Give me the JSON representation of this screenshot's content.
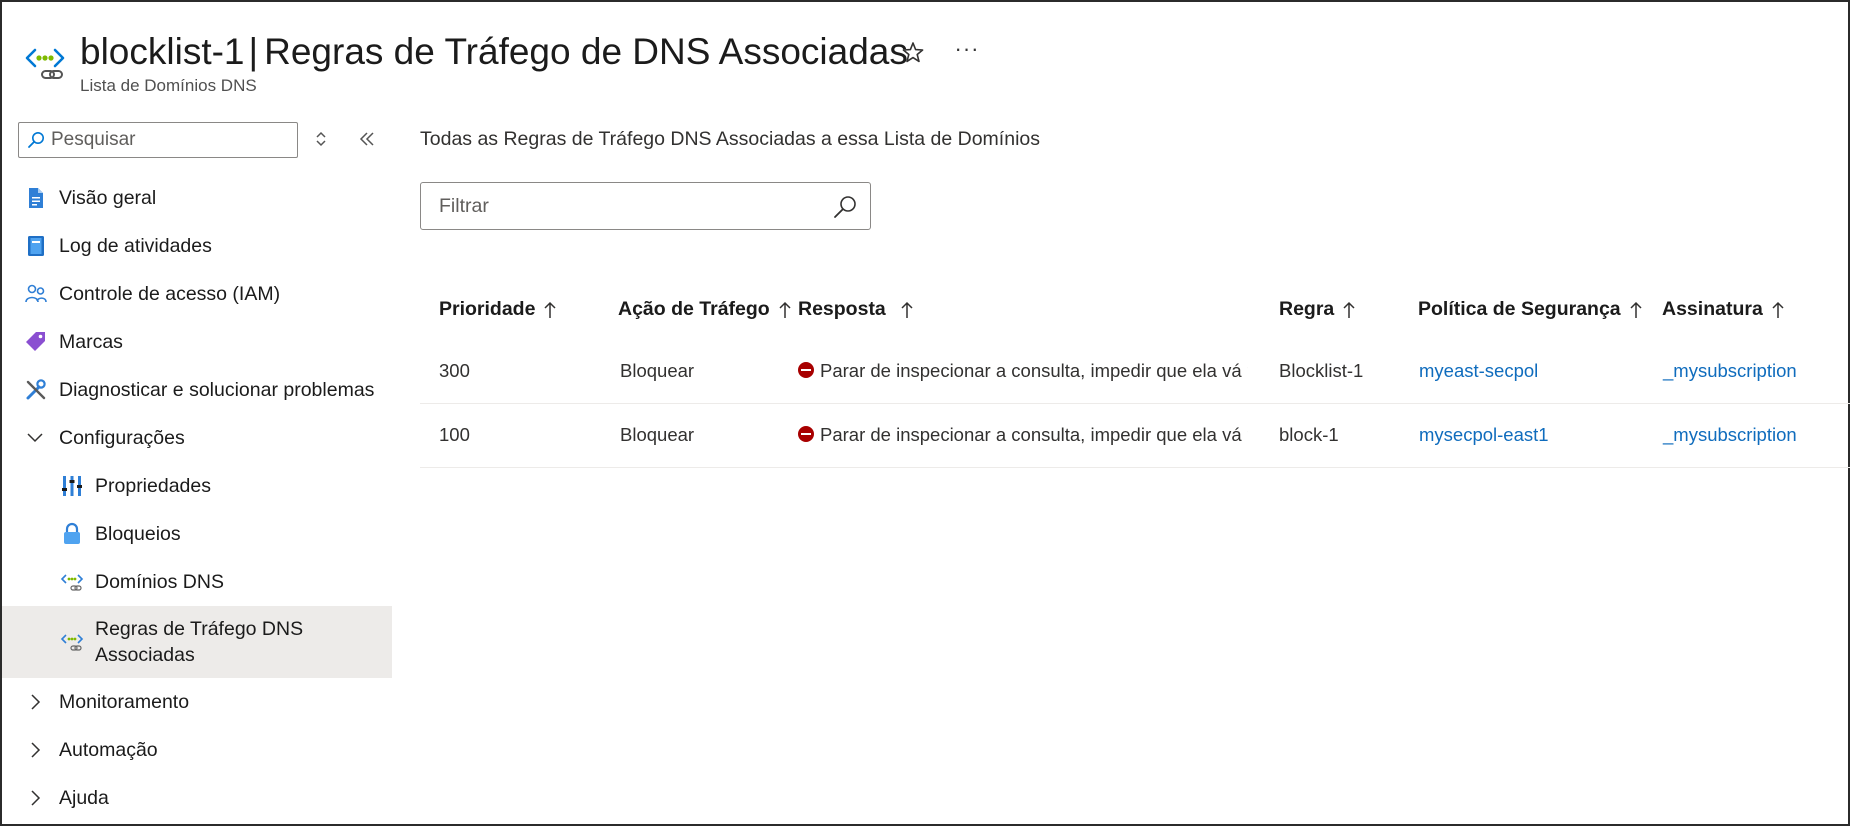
{
  "header": {
    "resource_name": "blocklist-1",
    "separator": "|",
    "page_title": "Regras de Tráfego de DNS Associadas",
    "subtitle": "Lista de Domínios DNS",
    "more_label": "···"
  },
  "sidebar": {
    "search_placeholder": "Pesquisar",
    "items": [
      {
        "label": "Visão geral",
        "icon": "document-icon"
      },
      {
        "label": "Log de atividades",
        "icon": "book-icon"
      },
      {
        "label": "Controle de acesso (IAM)",
        "icon": "people-icon"
      },
      {
        "label": "Marcas",
        "icon": "tag-icon"
      },
      {
        "label": "Diagnosticar e solucionar problemas",
        "icon": "wrench-icon"
      },
      {
        "label": "Configurações",
        "icon": "chevron-down-icon"
      },
      {
        "label": "Propriedades",
        "icon": "properties-icon"
      },
      {
        "label": "Bloqueios",
        "icon": "lock-icon"
      },
      {
        "label": "Domínios DNS",
        "icon": "dns-icon"
      },
      {
        "label": "Regras de Tráfego DNS Associadas",
        "icon": "dns-icon"
      },
      {
        "label": "Monitoramento",
        "icon": "chevron-right-icon"
      },
      {
        "label": "Automação",
        "icon": "chevron-right-icon"
      },
      {
        "label": "Ajuda",
        "icon": "chevron-right-icon"
      }
    ]
  },
  "main": {
    "description": "Todas as Regras de Tráfego DNS Associadas a essa Lista de Domínios",
    "filter_placeholder": "Filtrar",
    "columns": [
      "Prioridade",
      "Ação de Tráfego",
      "Resposta",
      "Regra",
      "Política de Segurança",
      "Assinatura"
    ],
    "rows": [
      {
        "priority": "300",
        "action": "Bloquear",
        "response": "Parar de inspecionar a consulta, impedir que ela vá para",
        "rule": "Blocklist-1",
        "policy": "myeast-secpol",
        "subscription": "_mysubscription"
      },
      {
        "priority": "100",
        "action": "Bloquear",
        "response": "Parar de inspecionar a consulta, impedir que ela vá para",
        "rule": "block-1",
        "policy": "mysecpol-east1",
        "subscription": "_mysubscription"
      }
    ]
  },
  "colors": {
    "accent": "#0f6cbd",
    "active_bg": "#edebe9",
    "stop": "#a80000"
  }
}
